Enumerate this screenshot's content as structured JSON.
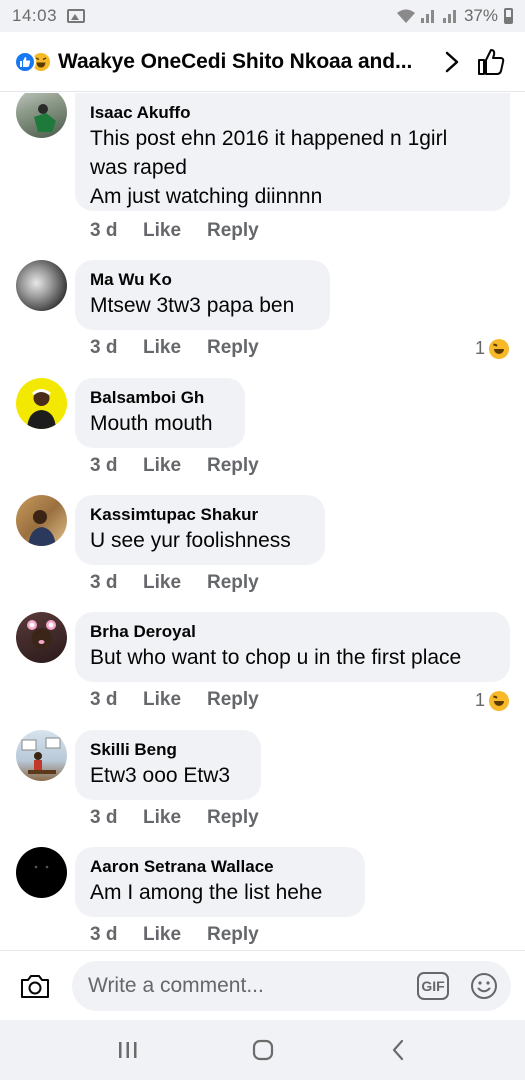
{
  "status_bar": {
    "time": "14:03",
    "battery": "37%"
  },
  "header": {
    "title": "Waakye OneCedi Shito Nkoaa and...",
    "icons": [
      "like-reaction-icon",
      "haha-reaction-icon",
      "chevron-right-icon",
      "thumbs-up-icon"
    ]
  },
  "comments": [
    {
      "name": "Isaac Akuffo",
      "lines": [
        "This post ehn 2016 it happened n 1girl",
        "was raped",
        "Am just watching diinnnn"
      ],
      "time": "3 d",
      "like": "Like",
      "reply": "Reply",
      "reaction_count": null
    },
    {
      "name": "Ma Wu Ko",
      "lines": [
        "Mtsew 3tw3 papa ben"
      ],
      "time": "3 d",
      "like": "Like",
      "reply": "Reply",
      "reaction_count": "1"
    },
    {
      "name": "Balsamboi Gh",
      "lines": [
        "Mouth mouth"
      ],
      "time": "3 d",
      "like": "Like",
      "reply": "Reply",
      "reaction_count": null
    },
    {
      "name": "Kassimtupac Shakur",
      "lines": [
        "U see yur foolishness"
      ],
      "time": "3 d",
      "like": "Like",
      "reply": "Reply",
      "reaction_count": null
    },
    {
      "name": "Brha Deroyal",
      "lines": [
        "But who want to chop u in the first place"
      ],
      "time": "3 d",
      "like": "Like",
      "reply": "Reply",
      "reaction_count": "1"
    },
    {
      "name": "Skilli Beng",
      "lines": [
        "Etw3 ooo Etw3"
      ],
      "time": "3 d",
      "like": "Like",
      "reply": "Reply",
      "reaction_count": null
    },
    {
      "name": "Aaron Setrana Wallace",
      "lines": [
        "Am I among the list hehe"
      ],
      "time": "3 d",
      "like": "Like",
      "reply": "Reply",
      "reaction_count": null
    }
  ],
  "composer": {
    "placeholder": "Write a comment...",
    "gif_label": "GIF"
  },
  "colors": {
    "bubble": "#f0f2f5",
    "meta_text": "#65676b",
    "facebook_blue": "#1877f2",
    "haha_yellow": "#f7b928"
  }
}
